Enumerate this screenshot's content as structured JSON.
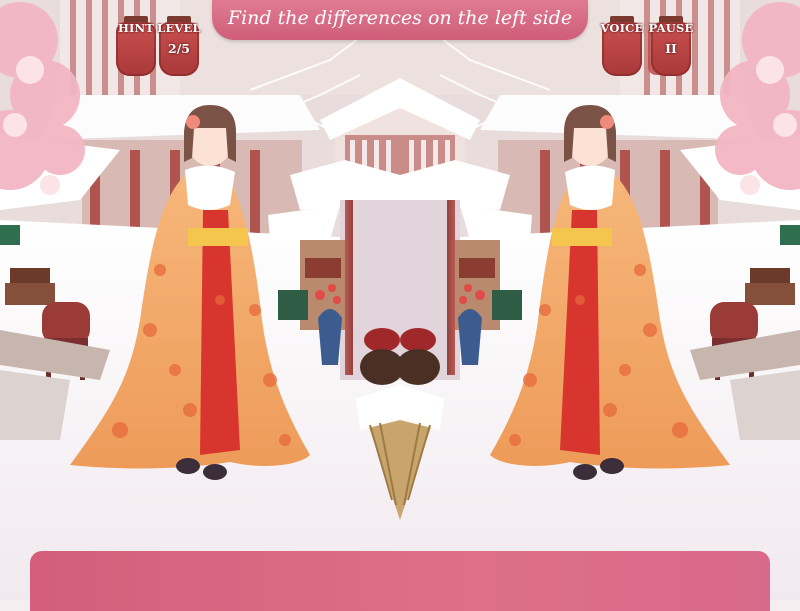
{
  "instruction": "Find the differences on the left side",
  "hud": {
    "hint_label": "HINT",
    "level_label": "LEVEL",
    "level_value": "2/5",
    "voice_label": "VOICE",
    "pause_label": "PAUSE",
    "pause_symbol": "II"
  },
  "colors": {
    "banner": "#d9667f",
    "bottom_panel": "#d8668a",
    "kimono": "#f2a464",
    "lantern": "#c04a4b"
  }
}
